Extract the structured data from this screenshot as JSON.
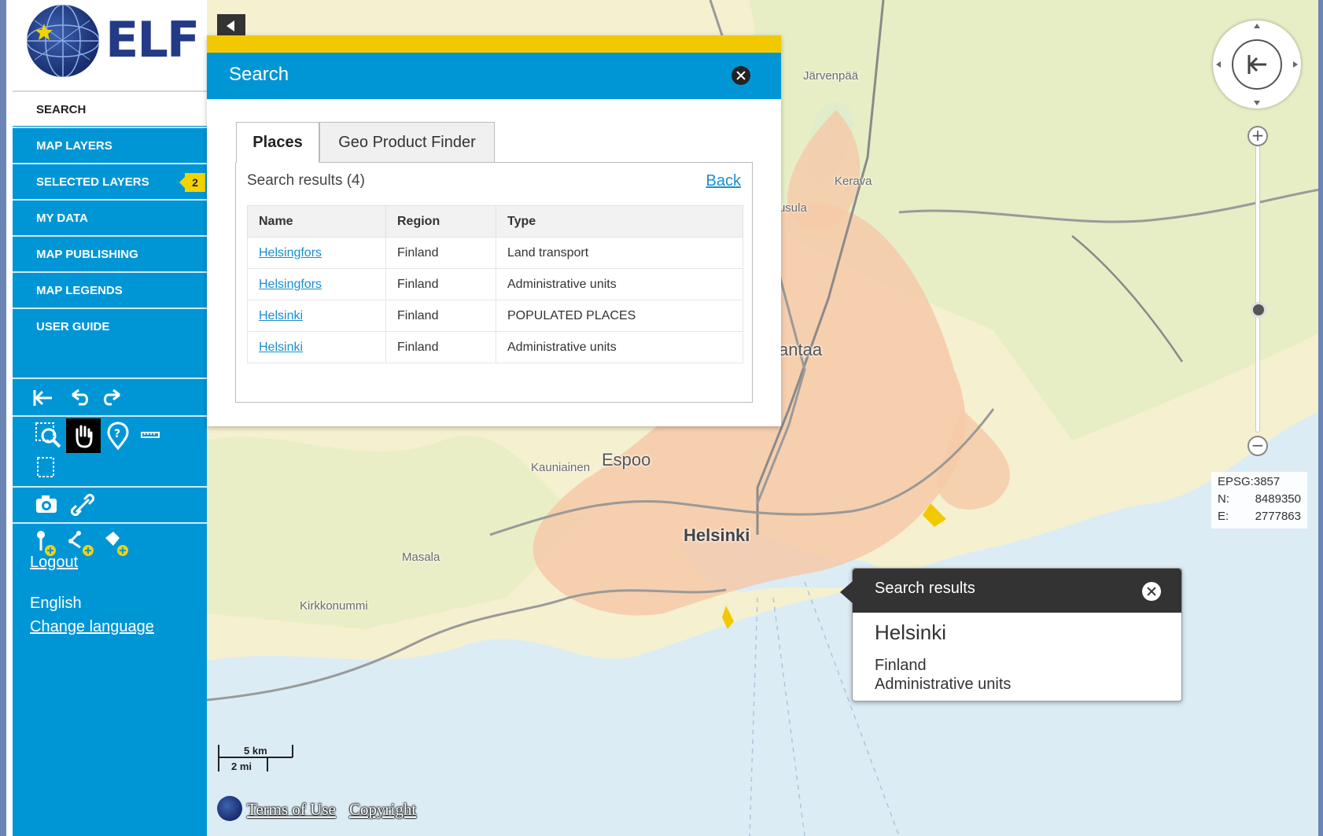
{
  "app": {
    "logo_text": "ELF"
  },
  "sidebar": {
    "items": [
      {
        "label": "SEARCH",
        "active": true
      },
      {
        "label": "MAP LAYERS"
      },
      {
        "label": "SELECTED LAYERS",
        "badge": "2"
      },
      {
        "label": "MY DATA"
      },
      {
        "label": "MAP PUBLISHING"
      },
      {
        "label": "MAP LEGENDS"
      },
      {
        "label": "USER GUIDE"
      }
    ],
    "tool_icons": [
      "reset-view-icon",
      "undo-icon",
      "redo-icon",
      "zoom-box-icon",
      "pan-hand-icon",
      "info-marker-icon",
      "measure-line-icon",
      "measure-area-icon",
      "camera-icon",
      "link-icon",
      "add-point-icon",
      "add-line-icon",
      "add-area-icon"
    ],
    "logout_label": "Logout",
    "language": "English",
    "change_language_label": "Change language"
  },
  "search": {
    "title": "Search",
    "tabs": [
      {
        "label": "Places",
        "active": true
      },
      {
        "label": "Geo Product Finder"
      }
    ],
    "results_count": "Search results (4)",
    "back_label": "Back",
    "columns": [
      "Name",
      "Region",
      "Type"
    ],
    "rows": [
      {
        "name": "Helsingfors",
        "region": "Finland",
        "type": "Land transport"
      },
      {
        "name": "Helsingfors",
        "region": "Finland",
        "type": "Administrative units"
      },
      {
        "name": "Helsinki",
        "region": "Finland",
        "type": "POPULATED PLACES"
      },
      {
        "name": "Helsinki",
        "region": "Finland",
        "type": "Administrative units"
      }
    ]
  },
  "map": {
    "places": [
      "Järvenpää",
      "Kerava",
      "Tuusula",
      "Vantaa",
      "Espoo",
      "Kauniainen",
      "Helsinki",
      "Masala",
      "Kirkkonummi"
    ],
    "colors": {
      "land": "#f5f0cf",
      "water": "#dcecf5",
      "urban": "#f6c9a8",
      "forest": "#e4edc2",
      "accent": "#0096d6",
      "highlight": "#f2c900"
    }
  },
  "coords": {
    "epsg": "EPSG:3857",
    "n_label": "N:",
    "n_value": "8489350",
    "e_label": "E:",
    "e_value": "2777863"
  },
  "popup": {
    "title": "Search results",
    "name": "Helsinki",
    "region": "Finland",
    "type": "Administrative units"
  },
  "scale": {
    "km": "5 km",
    "mi": "2 mi"
  },
  "footer": {
    "terms": "Terms of Use",
    "copyright": "Copyright"
  }
}
